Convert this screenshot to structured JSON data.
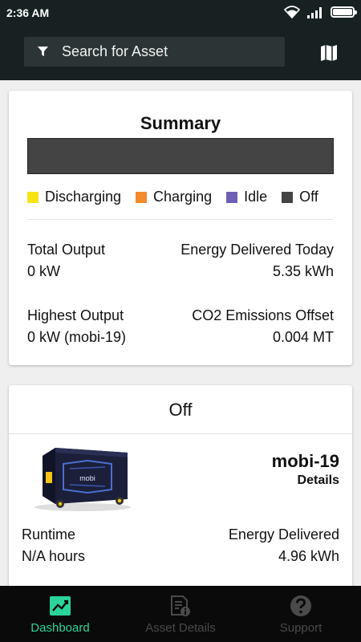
{
  "status_bar": {
    "time": "2:36 AM",
    "icons": [
      "wifi-icon",
      "signal-icon",
      "battery-icon"
    ]
  },
  "header": {
    "search_placeholder": "Search for Asset",
    "filter_icon": "filter-icon",
    "map_icon": "map-icon"
  },
  "summary": {
    "title": "Summary",
    "legend": [
      {
        "label": "Discharging",
        "color": "#f5e316"
      },
      {
        "label": "Charging",
        "color": "#f28a2e"
      },
      {
        "label": "Idle",
        "color": "#6f5fb5"
      },
      {
        "label": "Off",
        "color": "#444444"
      }
    ],
    "total_output_label": "Total Output",
    "total_output_value": "0 kW",
    "energy_today_label": "Energy Delivered Today",
    "energy_today_value": "5.35 kWh",
    "highest_output_label": "Highest Output",
    "highest_output_value": "0 kW (mobi-19)",
    "co2_label": "CO2 Emissions Offset",
    "co2_value": "0.004 MT"
  },
  "asset_card": {
    "status": "Off",
    "name": "mobi-19",
    "details_label": "Details",
    "runtime_label": "Runtime",
    "runtime_value": "N/A hours",
    "energy_label": "Energy Delivered",
    "energy_value": "4.96 kWh",
    "image_text": "mobi"
  },
  "bottom_nav": {
    "items": [
      {
        "label": "Dashboard",
        "icon": "chart-icon",
        "active": true
      },
      {
        "label": "Asset Details",
        "icon": "document-info-icon",
        "active": false
      },
      {
        "label": "Support",
        "icon": "help-icon",
        "active": false
      }
    ],
    "active_color": "#2bd49a"
  }
}
